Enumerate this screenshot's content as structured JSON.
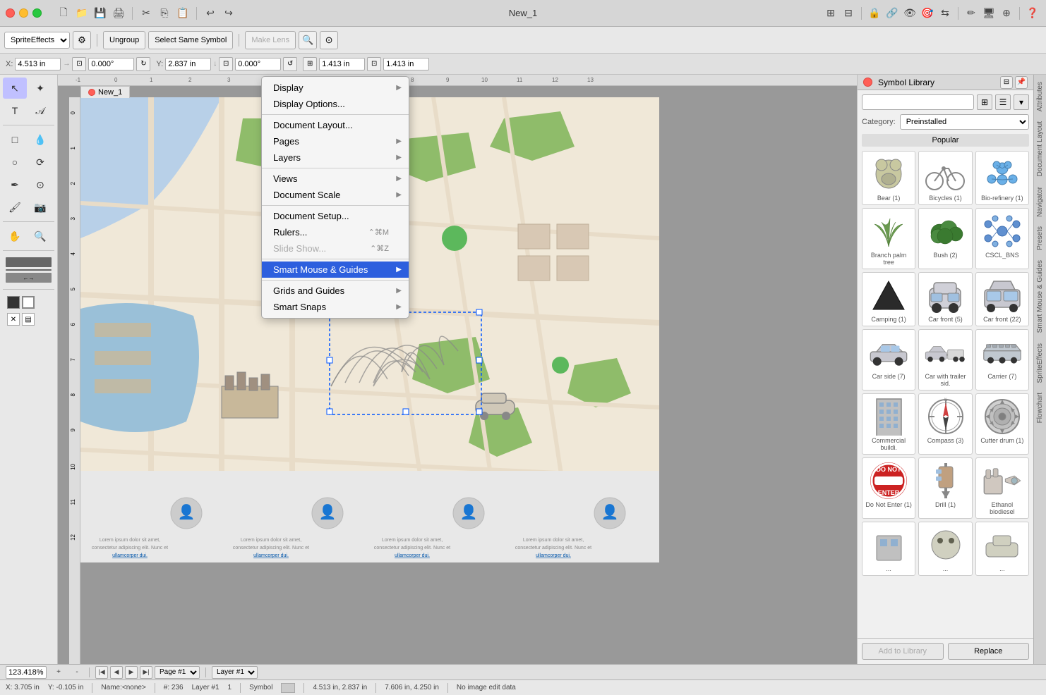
{
  "app": {
    "title": "New_1",
    "tab_title": "New_1"
  },
  "titlebar": {
    "title": "New_1"
  },
  "toolbar": {
    "new": "🗋",
    "open": "📂",
    "save": "💾",
    "print": "🖨",
    "cut": "✂",
    "copy": "⎘",
    "paste": "📋",
    "undo": "↩",
    "redo": "↪"
  },
  "coordinates": {
    "x_label": "X:",
    "x_value": "4.513 in",
    "y_label": "Y:",
    "y_value": "2.837 in",
    "w_value": "1.413 in",
    "h_value": "1.413 in",
    "r1_value": "0.000°",
    "r2_value": "0.000°"
  },
  "menu": {
    "items": [
      {
        "label": "Display",
        "has_submenu": true
      },
      {
        "label": "Display Options...",
        "has_submenu": false
      },
      {
        "separator": true
      },
      {
        "label": "Document Layout...",
        "has_submenu": false
      },
      {
        "label": "Pages",
        "has_submenu": true
      },
      {
        "label": "Layers",
        "has_submenu": true
      },
      {
        "separator": true
      },
      {
        "label": "Views",
        "has_submenu": true,
        "highlighted": false
      },
      {
        "label": "Document Scale",
        "has_submenu": true,
        "highlighted": false
      },
      {
        "separator": true
      },
      {
        "label": "Document Setup...",
        "has_submenu": false
      },
      {
        "label": "Rulers...",
        "has_submenu": false,
        "shortcut": "⌃⌘M"
      },
      {
        "label": "Slide Show...",
        "has_submenu": false,
        "shortcut": "⌃⌘Z",
        "disabled": true
      },
      {
        "separator": true
      },
      {
        "label": "Smart Mouse & Guides",
        "has_submenu": true,
        "highlighted": true
      },
      {
        "separator": true
      },
      {
        "label": "Grids and Guides",
        "has_submenu": true
      },
      {
        "label": "Smart Snaps",
        "has_submenu": true
      }
    ]
  },
  "symbol_library": {
    "title": "Symbol Library",
    "search_placeholder": "",
    "category_label": "Category:",
    "category_value": "Preinstalled",
    "popular_label": "Popular",
    "symbols": [
      {
        "name": "Bear (1)",
        "shape": "bear"
      },
      {
        "name": "Bicycles (1)",
        "shape": "bicycle"
      },
      {
        "name": "Bio-refinery (1)",
        "shape": "biorefinery"
      },
      {
        "name": "Branch palm tree",
        "shape": "palm"
      },
      {
        "name": "Bush (2)",
        "shape": "bush"
      },
      {
        "name": "CSCL_BNS",
        "shape": "molecule"
      },
      {
        "name": "Camping (1)",
        "shape": "camping"
      },
      {
        "name": "Car front (5)",
        "shape": "car_front_5"
      },
      {
        "name": "Car front (22)",
        "shape": "car_front_22"
      },
      {
        "name": "Car side (7)",
        "shape": "car_side_7"
      },
      {
        "name": "Car with trailer sid.",
        "shape": "car_trailer"
      },
      {
        "name": "Carrier (7)",
        "shape": "carrier"
      },
      {
        "name": "Commercial buildi.",
        "shape": "building"
      },
      {
        "name": "Compass (3)",
        "shape": "compass"
      },
      {
        "name": "Cutter drum (1)",
        "shape": "cutter_drum"
      },
      {
        "name": "Do Not Enter (1)",
        "shape": "do_not_enter"
      },
      {
        "name": "Drill (1)",
        "shape": "drill"
      },
      {
        "name": "Ethanol biodiesel",
        "shape": "ethanol"
      }
    ],
    "add_to_library": "Add to Library",
    "replace": "Replace"
  },
  "statusbar": {
    "zoom": "123.418%",
    "page": "Page #1",
    "layer": "Layer #1",
    "coords": "X: 3.705 in",
    "y_coord": "Y: -0.105 in",
    "name": "Name:<none>",
    "hash": "#: 236",
    "layer2": "Layer #1",
    "num": "1",
    "symbol_label": "Symbol",
    "position": "4.513 in, 2.837 in",
    "size": "7.606 in, 4.250 in",
    "image_info": "No image edit data"
  },
  "right_tabs": [
    "Attributes",
    "Document Layout",
    "Navigator",
    "Presets",
    "Smart Mouse & Guides",
    "SpriteEffects",
    "Flowchart"
  ],
  "canvas": {
    "tab_name": "New_1",
    "page_indicator": "Page #1",
    "layer_indicator": "Layer #1"
  },
  "toolbar2": {
    "ungroup": "Ungroup",
    "select_same_symbol": "Select Same Symbol",
    "make_lens": "Make Lens",
    "sprite_effects": "SpriteEffects"
  }
}
